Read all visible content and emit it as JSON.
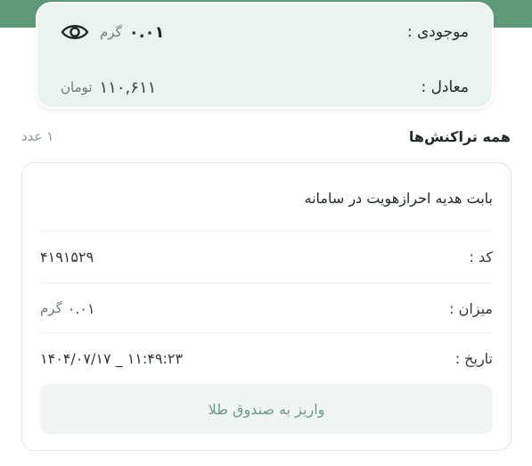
{
  "balance": {
    "stock_label": "موجودی :",
    "stock_amount": "۰.۰۱",
    "stock_unit": "گرم",
    "equivalent_label": "معادل :",
    "equivalent_amount": "۱۱۰,۶۱۱",
    "equivalent_unit": "تومان"
  },
  "transactions": {
    "section_title": "همه تراکنش‌ها",
    "count_text": "۱ عدد",
    "item": {
      "title": "بابت هدیه احرازهویت در سامانه",
      "code_label": "کد :",
      "code_value": "۴۱۹۱۵۲۹",
      "amount_label": "میزان :",
      "amount_value": "۰.۰۱",
      "amount_unit": "گرم",
      "date_label": "تاریخ :",
      "date_value": "۱۴۰۴/۰۷/۱۷ _ ۱۱:۴۹:۲۳",
      "deposit_button": "واریز به صندوق طلا"
    }
  },
  "icons": {
    "visibility": "eye-icon"
  },
  "colors": {
    "header": "#5e9a77",
    "card_bg": "#e9f4ef",
    "button_text": "#6d9c84",
    "button_bg": "#f0f4f3"
  }
}
